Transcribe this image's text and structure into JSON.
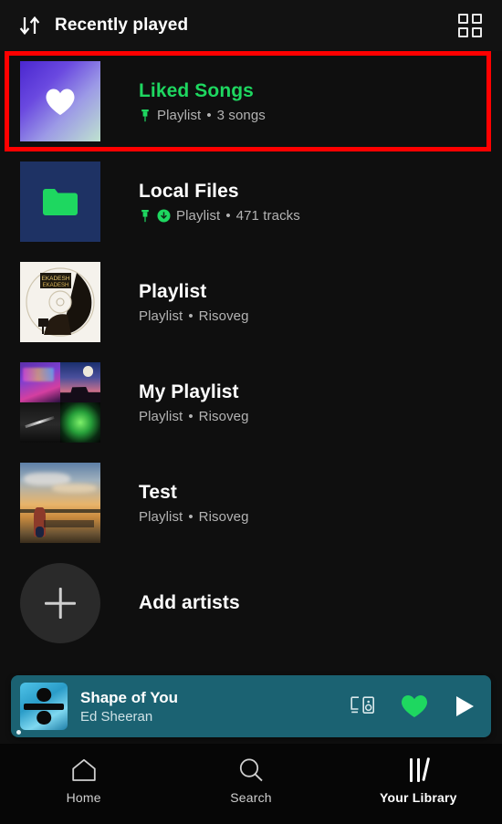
{
  "header": {
    "title": "Recently played",
    "sort_icon": "sort-down-up-icon",
    "grid_icon": "grid-view-icon"
  },
  "colors": {
    "background": "#0f0f0f",
    "accent_green": "#1ed760",
    "highlight_red": "#ff0000",
    "now_playing_bar": "#1b6272",
    "local_files_tile": "#1e3264",
    "secondary_text": "#b3b3b3"
  },
  "library": {
    "items": [
      {
        "title": "Liked Songs",
        "title_color": "green",
        "subtitle_type": "Playlist",
        "subtitle_detail": "3 songs",
        "separator": "•",
        "pinned": true,
        "downloaded": false,
        "artwork": "liked-songs-heart-gradient",
        "highlighted": true
      },
      {
        "title": "Local Files",
        "title_color": "white",
        "subtitle_type": "Playlist",
        "subtitle_detail": "471 tracks",
        "separator": "•",
        "pinned": true,
        "downloaded": true,
        "artwork": "local-files-folder",
        "highlighted": false
      },
      {
        "title": "Playlist",
        "title_color": "white",
        "subtitle_type": "Playlist",
        "subtitle_detail": "Risoveg",
        "separator": "•",
        "pinned": false,
        "downloaded": false,
        "artwork": "disc-cover",
        "highlighted": false
      },
      {
        "title": "My Playlist",
        "title_color": "white",
        "subtitle_type": "Playlist",
        "subtitle_detail": "Risoveg",
        "separator": "•",
        "pinned": false,
        "downloaded": false,
        "artwork": "four-tile-collage",
        "highlighted": false
      },
      {
        "title": "Test",
        "title_color": "white",
        "subtitle_type": "Playlist",
        "subtitle_detail": "Risoveg",
        "separator": "•",
        "pinned": false,
        "downloaded": false,
        "artwork": "sunset-photo",
        "highlighted": false
      }
    ],
    "add_artists": {
      "label": "Add artists",
      "icon": "plus-icon"
    }
  },
  "now_playing": {
    "title": "Shape of You",
    "artist": "Ed Sheeran",
    "artwork": "divide-album-cover",
    "device_icon": "connect-to-device-icon",
    "like_icon": "heart-filled-icon",
    "play_icon": "play-icon",
    "liked": true
  },
  "tabbar": {
    "tabs": [
      {
        "label": "Home",
        "icon": "home-icon",
        "active": false
      },
      {
        "label": "Search",
        "icon": "search-icon",
        "active": false
      },
      {
        "label": "Your Library",
        "icon": "library-icon",
        "active": true
      }
    ]
  }
}
